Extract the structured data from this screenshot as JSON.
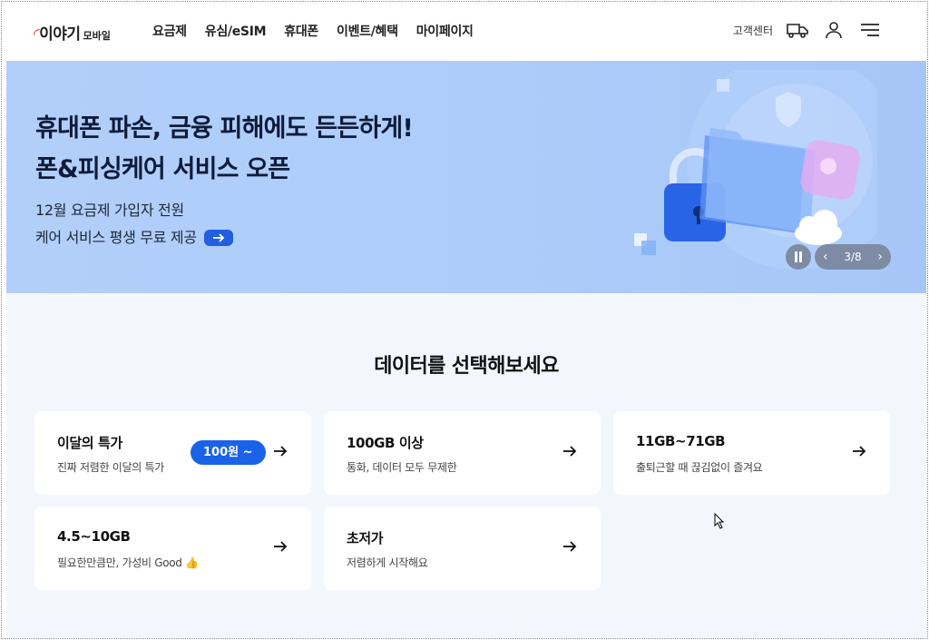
{
  "header": {
    "logo_brand": "이야기",
    "logo_sub": "모바일",
    "nav": [
      "요금제",
      "유심/eSIM",
      "휴대폰",
      "이벤트/혜택",
      "마이페이지"
    ],
    "util_link": "고객센터",
    "icons": [
      "truck-icon",
      "user-icon",
      "menu-icon"
    ]
  },
  "banner": {
    "title_line1": "휴대폰 파손, 금융 피해에도 든든하게!",
    "title_line2": "폰&피싱케어 서비스 오픈",
    "sub_line1": "12월 요금제 가입자 전원",
    "sub_line2": "케어 서비스 평생 무료 제공",
    "pager": "3/8",
    "current_slide": 3,
    "total_slides": 8,
    "colors": {
      "accent": "#1f5fe0",
      "background": "#aecdfa"
    }
  },
  "section": {
    "title": "데이터를 선택해보세요",
    "cards": [
      {
        "title": "이달의 특가",
        "desc": "진짜 저렴한 이달의 특가",
        "badge": "100원 ~"
      },
      {
        "title": "100GB 이상",
        "desc": "통화, 데이터 모두 무제한"
      },
      {
        "title": "11GB~71GB",
        "desc": "출퇴근할 때 끊김없이 즐겨요"
      },
      {
        "title": "4.5~10GB",
        "desc": "필요한만큼만, 가성비 Good 👍"
      },
      {
        "title": "초저가",
        "desc": "저렴하게 시작해요"
      }
    ]
  }
}
